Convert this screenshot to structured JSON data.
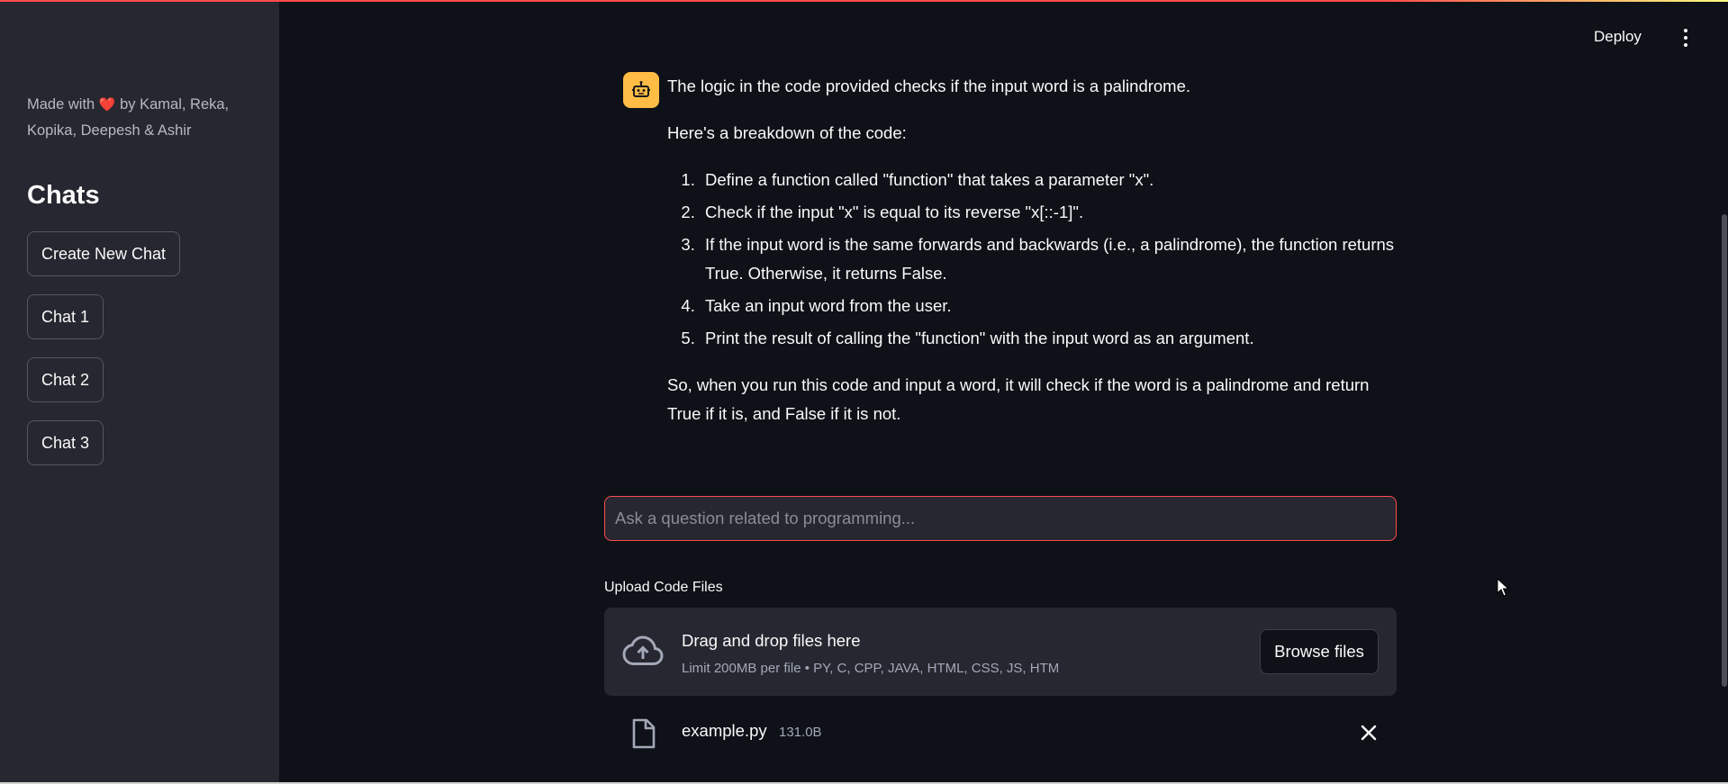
{
  "sidebar": {
    "made_with_prefix": "Made with",
    "heart": "❤️",
    "made_with_suffix": "by Kamal, Reka, Kopika, Deepesh & Ashir",
    "chats_title": "Chats",
    "create_new_chat": "Create New Chat",
    "chats": [
      {
        "label": "Chat 1"
      },
      {
        "label": "Chat 2"
      },
      {
        "label": "Chat 3"
      }
    ]
  },
  "header": {
    "deploy_label": "Deploy",
    "menu_icon": "vertical-ellipsis-icon"
  },
  "message": {
    "avatar_icon": "robot-icon",
    "intro": "The logic in the code provided checks if the input word is a palindrome.",
    "breakdown_intro": "Here's a breakdown of the code:",
    "steps": [
      "Define a function called \"function\" that takes a parameter \"x\".",
      "Check if the input \"x\" is equal to its reverse \"x[::-1]\".",
      "If the input word is the same forwards and backwards (i.e., a palindrome), the function returns True. Otherwise, it returns False.",
      "Take an input word from the user.",
      "Print the result of calling the \"function\" with the input word as an argument."
    ],
    "conclusion": "So, when you run this code and input a word, it will check if the word is a palindrome and return True if it is, and False if it is not."
  },
  "chat_input": {
    "placeholder": "Ask a question related to programming...",
    "value": ""
  },
  "uploader": {
    "label": "Upload Code Files",
    "dropzone_title": "Drag and drop files here",
    "dropzone_limit": "Limit 200MB per file • PY, C, CPP, JAVA, HTML, CSS, JS, HTM",
    "browse_label": "Browse files",
    "upload_icon": "cloud-upload-icon",
    "file": {
      "name": "example.py",
      "size": "131.0B",
      "icon": "file-icon",
      "remove_icon": "close-icon"
    }
  },
  "colors": {
    "background": "#0e1117",
    "sidebar": "#262730",
    "accent": "#ff4b4b",
    "avatar": "#ffbd45"
  }
}
